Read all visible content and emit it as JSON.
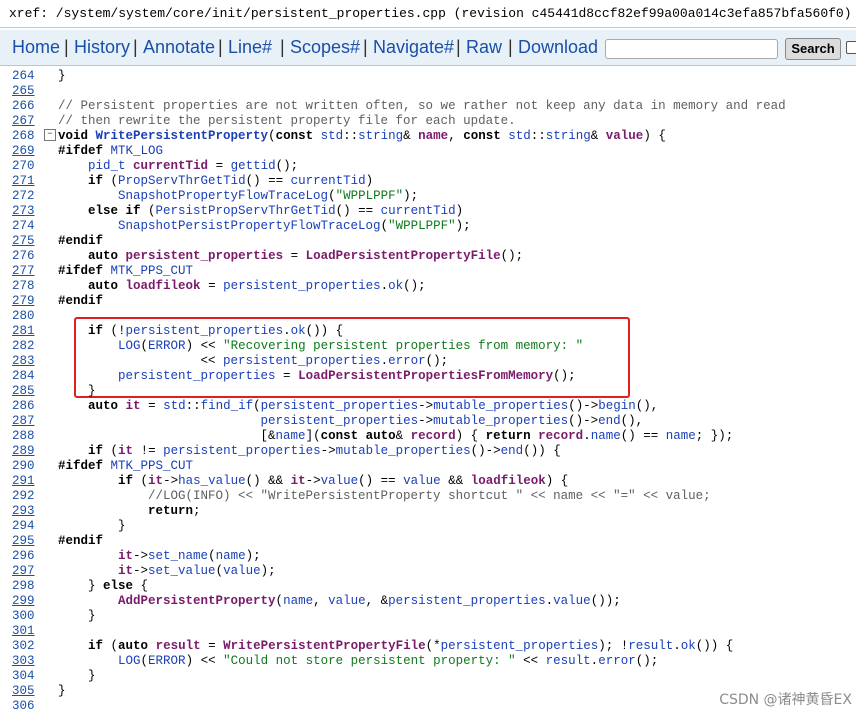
{
  "xref": "xref: /system/system/core/init/persistent_properties.cpp (revision c45441d8ccf82ef99a00a014c3efa857bfa560f0)",
  "nav": {
    "home": "Home",
    "history": "History",
    "annotate": "Annotate",
    "line": "Line#",
    "scopes": "Scopes#",
    "navigate": "Navigate#",
    "raw": "Raw",
    "download": "Download",
    "separator": "|",
    "search_value": "",
    "search_button": "Search"
  },
  "code_lines": [
    {
      "n": "264",
      "html": "}"
    },
    {
      "n": "265",
      "html": ""
    },
    {
      "n": "266",
      "html": "<span class='c'>// Persistent properties are not written often, so we rather not keep any data in memory and read</span>"
    },
    {
      "n": "267",
      "html": "<span class='c'>// then rewrite the persistent property file for each update.</span>"
    },
    {
      "n": "268",
      "html": "<span class='k'>void</span> <span class='fb'>WritePersistentProperty</span>(<span class='k'>const</span> <span class='m'>std</span>::<span class='m'>string</span>&amp; <span class='v'>name</span>, <span class='k'>const</span> <span class='m'>std</span>::<span class='m'>string</span>&amp; <span class='v'>value</span>) {"
    },
    {
      "n": "269",
      "html": "<span class='pp'>#ifdef</span> <span class='m'>MTK_LOG</span>"
    },
    {
      "n": "270",
      "html": "    <span class='m'>pid_t</span> <span class='v'>currentTid</span> = <span class='m'>gettid</span>();"
    },
    {
      "n": "271",
      "html": "    <span class='k'>if</span> (<span class='m'>PropServThrGetTid</span>() == <span class='m'>currentTid</span>)"
    },
    {
      "n": "272",
      "html": "        <span class='m'>SnapshotPropertyFlowTraceLog</span>(<span class='s'>\"WPPLPPF\"</span>);"
    },
    {
      "n": "273",
      "html": "    <span class='k'>else if</span> (<span class='m'>PersistPropServThrGetTid</span>() == <span class='m'>currentTid</span>)"
    },
    {
      "n": "274",
      "html": "        <span class='m'>SnapshotPersistPropertyFlowTraceLog</span>(<span class='s'>\"WPPLPPF\"</span>);"
    },
    {
      "n": "275",
      "html": "<span class='pp'>#endif</span>"
    },
    {
      "n": "276",
      "html": "    <span class='k'>auto</span> <span class='vp'>persistent_properties</span> = <span class='vp'>LoadPersistentPropertyFile</span>();"
    },
    {
      "n": "277",
      "html": "<span class='pp'>#ifdef</span> <span class='m'>MTK_PPS_CUT</span>"
    },
    {
      "n": "278",
      "html": "    <span class='k'>auto</span> <span class='v'>loadfileok</span> = <span class='m'>persistent_properties</span>.<span class='m'>ok</span>();"
    },
    {
      "n": "279",
      "html": "<span class='pp'>#endif</span>"
    },
    {
      "n": "280",
      "html": ""
    },
    {
      "n": "281",
      "html": "    <span class='k'>if</span> (!<span class='m'>persistent_properties</span>.<span class='m'>ok</span>()) {"
    },
    {
      "n": "282",
      "html": "        <span class='m'>LOG</span>(<span class='m'>ERROR</span>) &lt;&lt; <span class='s'>\"Recovering persistent properties from memory: \"</span>"
    },
    {
      "n": "283",
      "html": "                   &lt;&lt; <span class='m'>persistent_properties</span>.<span class='m'>error</span>();"
    },
    {
      "n": "284",
      "html": "        <span class='m'>persistent_properties</span> = <span class='vp'>LoadPersistentPropertiesFromMemory</span>();"
    },
    {
      "n": "285",
      "html": "    }"
    },
    {
      "n": "286",
      "html": "    <span class='k'>auto</span> <span class='vp'>it</span> = <span class='m'>std</span>::<span class='m'>find_if</span>(<span class='m'>persistent_properties</span>-&gt;<span class='m'>mutable_properties</span>()-&gt;<span class='m'>begin</span>(),"
    },
    {
      "n": "287",
      "html": "                           <span class='m'>persistent_properties</span>-&gt;<span class='m'>mutable_properties</span>()-&gt;<span class='m'>end</span>(),"
    },
    {
      "n": "288",
      "html": "                           [&amp;<span class='m'>name</span>](<span class='k'>const auto</span>&amp; <span class='v'>record</span>) { <span class='k'>return</span> <span class='v'>record</span>.<span class='m'>name</span>() == <span class='m'>name</span>; });"
    },
    {
      "n": "289",
      "html": "    <span class='k'>if</span> (<span class='vp'>it</span> != <span class='m'>persistent_properties</span>-&gt;<span class='m'>mutable_properties</span>()-&gt;<span class='m'>end</span>()) {"
    },
    {
      "n": "290",
      "html": "<span class='pp'>#ifdef</span> <span class='m'>MTK_PPS_CUT</span>"
    },
    {
      "n": "291",
      "html": "        <span class='k'>if</span> (<span class='vp'>it</span>-&gt;<span class='m'>has_value</span>() &amp;&amp; <span class='vp'>it</span>-&gt;<span class='m'>value</span>() == <span class='m'>value</span> &amp;&amp; <span class='v'>loadfileok</span>) {"
    },
    {
      "n": "292",
      "html": "            <span class='c'>//LOG(INFO) &lt;&lt; \"WritePersistentProperty shortcut \" &lt;&lt; name &lt;&lt; \"=\" &lt;&lt; value;</span>"
    },
    {
      "n": "293",
      "html": "            <span class='k'>return</span>;"
    },
    {
      "n": "294",
      "html": "        }"
    },
    {
      "n": "295",
      "html": "<span class='pp'>#endif</span>"
    },
    {
      "n": "296",
      "html": "        <span class='vp'>it</span>-&gt;<span class='m'>set_name</span>(<span class='m'>name</span>);"
    },
    {
      "n": "297",
      "html": "        <span class='vp'>it</span>-&gt;<span class='m'>set_value</span>(<span class='m'>value</span>);"
    },
    {
      "n": "298",
      "html": "    } <span class='k'>else</span> {"
    },
    {
      "n": "299",
      "html": "        <span class='vp'>AddPersistentProperty</span>(<span class='m'>name</span>, <span class='m'>value</span>, &amp;<span class='m'>persistent_properties</span>.<span class='m'>value</span>());"
    },
    {
      "n": "300",
      "html": "    }"
    },
    {
      "n": "301",
      "html": ""
    },
    {
      "n": "302",
      "html": "    <span class='k'>if</span> (<span class='k'>auto</span> <span class='v'>result</span> = <span class='vp'>WritePersistentPropertyFile</span>(*<span class='m'>persistent_properties</span>); !<span class='m'>result</span>.<span class='m'>ok</span>()) {"
    },
    {
      "n": "303",
      "html": "        <span class='m'>LOG</span>(<span class='m'>ERROR</span>) &lt;&lt; <span class='s'>\"Could not store persistent property: \"</span> &lt;&lt; <span class='m'>result</span>.<span class='m'>error</span>();"
    },
    {
      "n": "304",
      "html": "    }"
    },
    {
      "n": "305",
      "html": "}"
    },
    {
      "n": "306",
      "html": ""
    }
  ],
  "fold_icon": "minus-box-icon",
  "highlight_color": "#e0201c",
  "watermark": "CSDN @诸神黄昏EX"
}
